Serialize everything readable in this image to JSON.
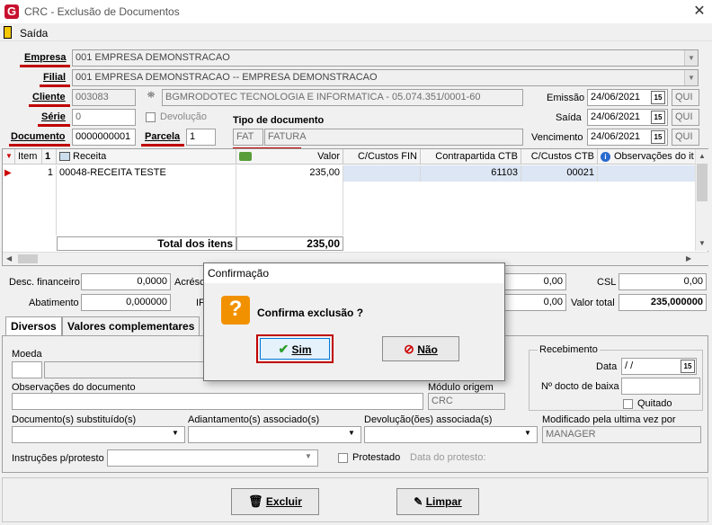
{
  "window": {
    "title": "CRC - Exclusão de Documentos",
    "app_icon": "G",
    "close": "✕"
  },
  "menu": {
    "saida": "Saída"
  },
  "labels": {
    "empresa": "Empresa",
    "filial": "Filial",
    "cliente": "Cliente",
    "serie": "Série",
    "documento": "Documento",
    "parcela": "Parcela",
    "tipo_documento": "Tipo de documento",
    "devolucao": "Devolução",
    "emissao": "Emissão",
    "saida": "Saída",
    "vencimento": "Vencimento"
  },
  "fields": {
    "empresa": "001 EMPRESA DEMONSTRACAO",
    "filial": "001 EMPRESA DEMONSTRACAO -- EMPRESA DEMONSTRACAO",
    "cliente_code": "003083",
    "cliente_name": "BGMRODOTEC TECNOLOGIA  E INFORMATICA - 05.074.351/0001-60",
    "serie": "0",
    "documento": "0000000001",
    "parcela": "1",
    "tipo_code": "FAT",
    "tipo_name": "FATURA",
    "emissao": "24/06/2021",
    "saida": "24/06/2021",
    "vencimento": "24/06/2021",
    "dow_emissao": "QUI",
    "dow_saida": "QUI",
    "dow_vencimento": "QUI"
  },
  "grid": {
    "headers": [
      "Item",
      "1",
      "Receita",
      "Valor",
      "C/Custos FIN",
      "Contrapartida CTB",
      "C/Custos CTB",
      "Observações do it"
    ],
    "row": {
      "item": "1",
      "receita": "00048-RECEITA TESTE",
      "valor": "235,00",
      "contrapartida": "61103",
      "ccustos_ctb": "00021"
    },
    "total_label": "Total dos itens",
    "total_value": "235,00"
  },
  "totals": {
    "desc_financeiro_label": "Desc. financeiro",
    "desc_financeiro": "0,0000",
    "acrescimo_label": "Acrésc",
    "abatimento_label": "Abatimento",
    "abatimento": "0,000000",
    "if_label": "IF",
    "mid_value1": "0,00",
    "mid_value2": "0,00",
    "csl_label": "CSL",
    "csl": "0,00",
    "valor_total_label": "Valor total",
    "valor_total": "235,000000"
  },
  "tabs": {
    "diversos": "Diversos",
    "valores_complementares": "Valores complementares"
  },
  "diversos": {
    "moeda": "Moeda",
    "observacoes": "Observações do documento",
    "modulo_origem": "Módulo origem",
    "modulo_origem_value": "CRC",
    "recebimento": "Recebimento",
    "data": "Data",
    "data_value": "/ /",
    "n_docto_baixa": "Nº docto de baixa",
    "quitado": "Quitado",
    "doc_substituidos": "Documento(s) substituído(s)",
    "adiantamentos": "Adiantamento(s) associado(s)",
    "devolucoes": "Devolução(ões) associada(s)",
    "modificado_por": "Modificado pela ultima vez por",
    "modificado_por_value": "MANAGER",
    "instrucoes": "Instruções p/protesto",
    "protestado": "Protestado",
    "data_protesto": "Data do protesto:"
  },
  "buttons": {
    "excluir": "Excluir",
    "limpar": "Limpar"
  },
  "dialog": {
    "title": "Confirmação",
    "message": "Confirma exclusão ?",
    "icon": "?",
    "sim": "Sim",
    "nao": "Não"
  },
  "colors": {
    "highlight_red": "#c00000",
    "selected_row": "#dce6f4",
    "question_icon": "#f29100"
  }
}
